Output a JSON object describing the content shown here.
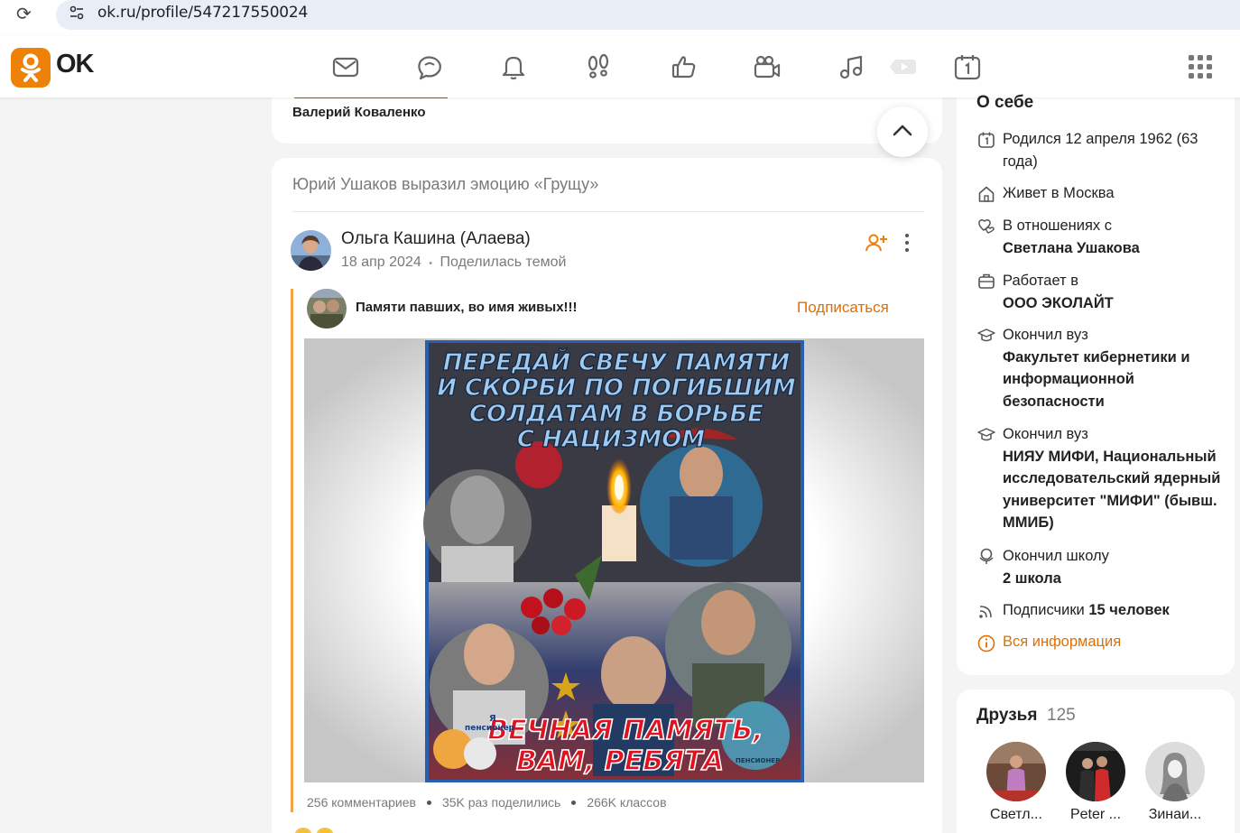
{
  "browser": {
    "reload_icon": "reload-icon",
    "url": "ok.ru/profile/547217550024"
  },
  "header": {
    "logo_text": "OK",
    "nav_icons": [
      "mail-icon",
      "chat-icon",
      "bell-icon",
      "footprints-icon",
      "like-icon",
      "video-camera-icon",
      "music-icon",
      "play-icon",
      "calendar-icon"
    ],
    "apps_icon": "apps-grid-icon"
  },
  "previous_post": {
    "author": "Валерий Коваленко"
  },
  "post": {
    "activity": "Юрий Ушаков выразил эмоцию «Грущу»",
    "author_name": "Ольга Кашина (Алаева)",
    "date": "18 апр 2024",
    "meta_sep": "•",
    "shared_text": "Поделилась темой",
    "group_name": "Памяти павших, во имя живых!!!",
    "subscribe_label": "Подписаться",
    "image": {
      "title_line1": "ПЕРЕДАЙ СВЕЧУ ПАМЯТИ",
      "title_line2": "И СКОРБИ ПО ПОГИБШИМ",
      "title_line3": "СОЛДАТАМ В БОРЬБЕ",
      "title_line4": "С НАЦИЗМОМ",
      "bottom_line1": "ВЕЧНАЯ ПАМЯТЬ,",
      "bottom_line2": "ВАМ, РЕБЯТА",
      "badge_small": "Я",
      "badge_text": "пенсионер",
      "badge_right": "ПЕНСИОНЕР"
    },
    "stats": {
      "comments": "256 комментариев",
      "shares": "35K раз поделились",
      "classes": "266K классов"
    }
  },
  "about": {
    "title": "О себе",
    "born": "Родился 12 апреля 1962 (63 года)",
    "lives_prefix": "Живет в",
    "lives_city": "Москва",
    "relationship_prefix": "В отношениях с",
    "relationship_name": "Светлана Ушакова",
    "works_prefix": "Работает в",
    "works_company": "ООО ЭКОЛАЙТ",
    "uni1_prefix": "Окончил вуз",
    "uni1_name": "Факультет кибернетики и информационной безопасности",
    "uni2_prefix": "Окончил вуз",
    "uni2_name": "НИЯУ МИФИ, Национальный исследовательский ядерный университет \"МИФИ\" (бывш. ММИБ)",
    "school_prefix": "Окончил школу",
    "school_name": "2 школа",
    "subscribers_prefix": "Подписчики",
    "subscribers_count": "15 человек",
    "all_info": "Вся информация"
  },
  "friends": {
    "title": "Друзья",
    "count": "125",
    "items": [
      {
        "name": "Светл..."
      },
      {
        "name": "Peter ..."
      },
      {
        "name": "Зинаи..."
      }
    ]
  },
  "colors": {
    "accent": "#ee8208",
    "link_orange": "#e06f00",
    "quote_bar": "#f7a24a"
  }
}
